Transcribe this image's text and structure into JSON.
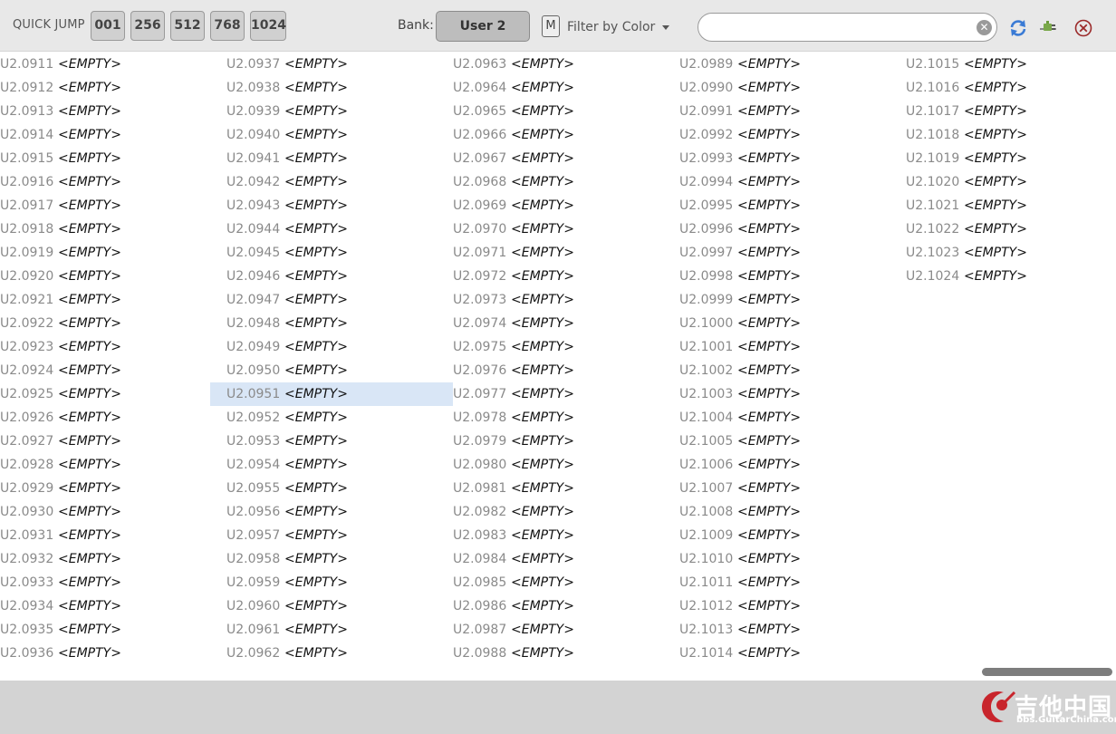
{
  "toolbar": {
    "quick_jump_label": "QUICK JUMP",
    "quick_jump_buttons": [
      "001",
      "256",
      "512",
      "768",
      "1024"
    ],
    "bank_label": "Bank:",
    "bank_value": "User 2",
    "m_label": "M",
    "filter_label": "Filter by Color",
    "search_value": "",
    "search_placeholder": "",
    "clear_glyph": "✕",
    "icons": [
      "refresh-icon",
      "plug-icon",
      "close-icon"
    ]
  },
  "preset_list": {
    "columns": [
      {
        "start": 911,
        "end": 936
      },
      {
        "start": 937,
        "end": 962
      },
      {
        "start": 963,
        "end": 988
      },
      {
        "start": 989,
        "end": 1014
      },
      {
        "start": 1015,
        "end": 1024
      }
    ],
    "prefix": "U2.",
    "empty_label": "<EMPTY>",
    "selected": "U2.0951"
  },
  "watermark": {
    "text": "吉他中国",
    "url": "bbs.GuitarChina.com"
  },
  "colors": {
    "toolbar_bg": "#e8e8e8",
    "selected_row": "#d9e6f6",
    "refresh_icon": "#3a7bd5",
    "plug_icon": "#6a9a3a",
    "close_icon": "#9b2a2a",
    "watermark_red": "#c8252c"
  }
}
